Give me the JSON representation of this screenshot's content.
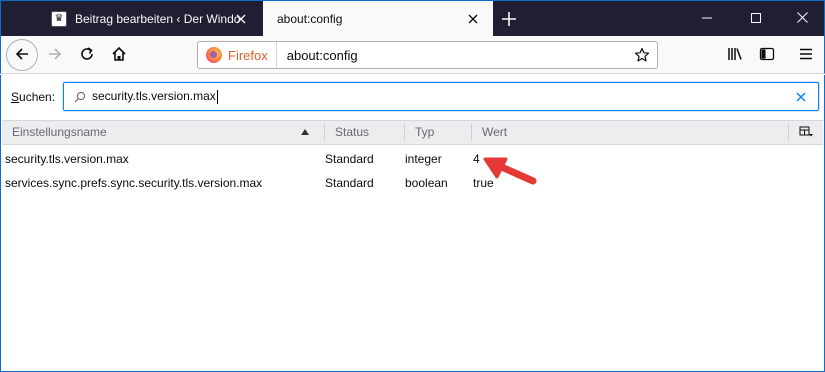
{
  "tabs": [
    {
      "title": "Beitrag bearbeiten ‹ Der Windo",
      "favicon": "crown-icon",
      "active": false
    },
    {
      "title": "about:config",
      "active": true
    }
  ],
  "window_controls": [
    "minimize-icon",
    "maximize-icon",
    "close-icon"
  ],
  "navbar": {
    "brand": "Firefox",
    "url": "about:config"
  },
  "search": {
    "label_prefix": "S",
    "label_rest": "uchen:",
    "value": "security.tls.version.max"
  },
  "table": {
    "columns": [
      "Einstellungsname",
      "Status",
      "Typ",
      "Wert"
    ],
    "rows": [
      {
        "name": "security.tls.version.max",
        "status": "Standard",
        "type": "integer",
        "value": "4"
      },
      {
        "name": "services.sync.prefs.sync.security.tls.version.max",
        "status": "Standard",
        "type": "boolean",
        "value": "true"
      }
    ]
  },
  "colors": {
    "tabstrip": "#1f1e33",
    "focus_blue": "#0a84ff",
    "firefox_brand": "#d8622f",
    "annotation_arrow": "#e53935"
  }
}
